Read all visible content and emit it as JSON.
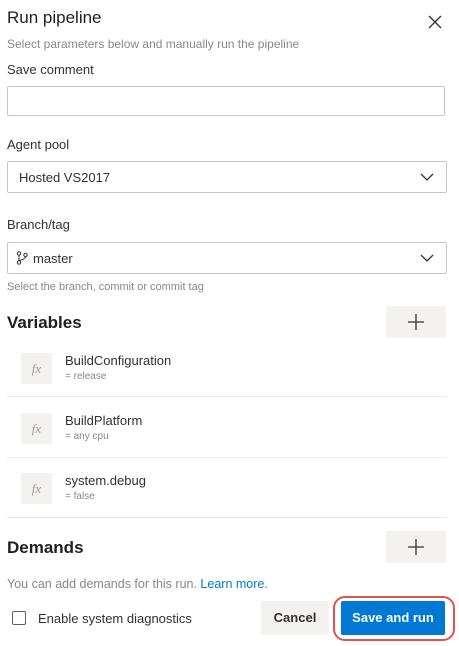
{
  "panel": {
    "title": "Run pipeline",
    "subtitle": "Select parameters below and manually run the pipeline",
    "close_icon": "close-icon"
  },
  "save_comment": {
    "label": "Save comment",
    "value": "",
    "placeholder": ""
  },
  "agent_pool": {
    "label": "Agent pool",
    "selected": "Hosted VS2017"
  },
  "branch": {
    "label": "Branch/tag",
    "selected": "master",
    "icon": "branch-icon",
    "hint": "Select the branch, commit or commit tag"
  },
  "variables": {
    "title": "Variables",
    "items": [
      {
        "name": "BuildConfiguration",
        "value": "= release"
      },
      {
        "name": "BuildPlatform",
        "value": "= any cpu"
      },
      {
        "name": "system.debug",
        "value": "= false"
      }
    ]
  },
  "demands": {
    "title": "Demands",
    "text": "You can add demands for this run. ",
    "link": "Learn more."
  },
  "footer": {
    "diagnostics_label": "Enable system diagnostics",
    "diagnostics_checked": false,
    "cancel_label": "Cancel",
    "save_label": "Save and run"
  },
  "colors": {
    "primary": "#0078d4",
    "highlight": "#e25151"
  }
}
